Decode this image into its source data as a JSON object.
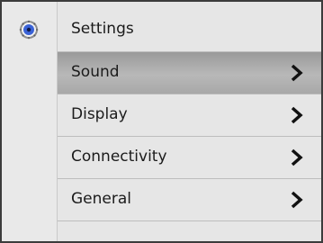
{
  "header": {
    "title": "Settings",
    "icon": "gear-icon"
  },
  "menu": {
    "items": [
      {
        "label": "Sound",
        "selected": true,
        "icon": "chevron-right-icon"
      },
      {
        "label": "Display",
        "selected": false,
        "icon": "chevron-right-icon"
      },
      {
        "label": "Connectivity",
        "selected": false,
        "icon": "chevron-right-icon"
      },
      {
        "label": "General",
        "selected": false,
        "icon": "chevron-right-icon"
      }
    ]
  },
  "colors": {
    "frame": "#3c3c3c",
    "background": "#e6e6e6",
    "selected": "#a9a9a9",
    "gear_blue": "#2a5bd8"
  }
}
